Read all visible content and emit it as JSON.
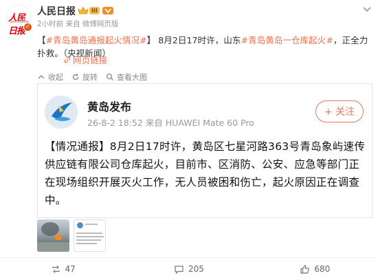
{
  "header": {
    "username": "人民日报",
    "avatar_text": "人民日报",
    "level_badge": "III",
    "time": "2小时前",
    "source": "来自 微博网页版"
  },
  "post": {
    "topic1": "#青岛黄岛通报起火情况#",
    "text1": " 8月2日17时许，山东",
    "topic2": "#青岛黄岛一仓库起火#",
    "text2": "，正全力扑救。（央视新闻）",
    "web_link": "网页链接",
    "bracket_open": "【",
    "bracket_close": "】"
  },
  "actions": {
    "collapse": "收起",
    "rotate": "旋转",
    "view_large": "查看大图"
  },
  "card": {
    "source_name": "黄岛发布",
    "source_meta": "26-8-2 18:52  来自 HUAWEI Mate 60 Pro",
    "follow": "+ 关注",
    "body": "【情况通报】8月2日17时许，黄岛区七星河路363号青岛象屿速传供应链有限公司仓库起火，目前市、区消防、公安、应急等部门正在现场组织开展灭火工作，无人员被困和伤亡，起火原因正在调查中。"
  },
  "footer": {
    "reposts": "47",
    "comments": "205",
    "likes": "680"
  },
  "colors": {
    "accent": "#eb7350",
    "brand_red": "#d7000f"
  }
}
